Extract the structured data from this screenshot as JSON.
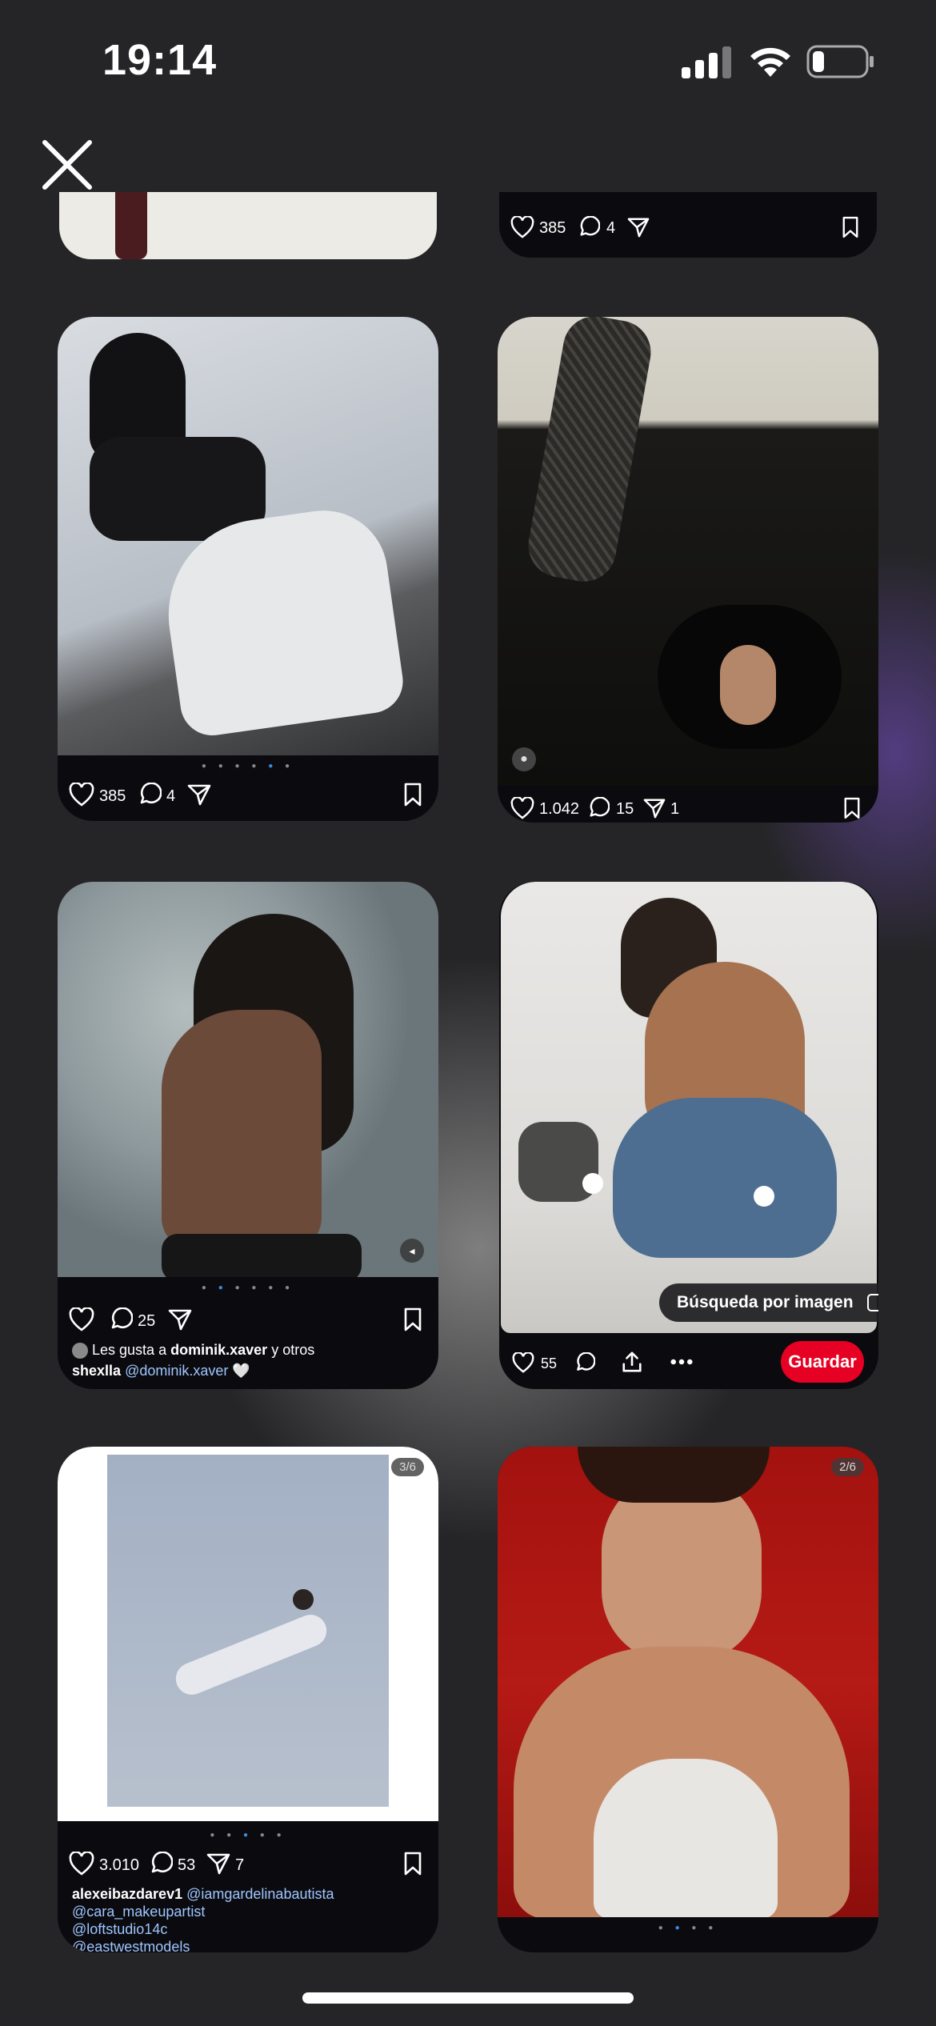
{
  "status_bar": {
    "time": "19:14"
  },
  "cards": {
    "top_left": {},
    "top_right": {
      "likes": "385",
      "comments": "4"
    },
    "card1": {
      "likes": "385",
      "comments": "4"
    },
    "card2": {
      "likes": "1.042",
      "comments": "15",
      "shares": "1"
    },
    "card3": {
      "comments": "25",
      "liked_by_prefix": "Les gusta a",
      "liked_by_user": "dominik.xaver",
      "liked_by_suffix": "y otros",
      "caption_user": "shexlla",
      "caption_mention": "@dominik.xaver",
      "caption_emoji": "🤍"
    },
    "card4": {
      "likes": "55",
      "lens_label": "Búsqueda por imagen",
      "save_label": "Guardar"
    },
    "card5": {
      "counter": "3/6",
      "likes": "3.010",
      "comments": "53",
      "shares": "7",
      "caption_user": "alexeibazdarev1",
      "mentions": [
        "@iamgardelinabautista",
        "@cara_makeupartist",
        "@loftstudio14c",
        "@eastwestmodels"
      ]
    },
    "card6": {
      "counter": "2/6"
    }
  },
  "colors": {
    "accent_red": "#e60023",
    "dot_active": "#3a8de0",
    "mention": "#9ec5ff"
  }
}
